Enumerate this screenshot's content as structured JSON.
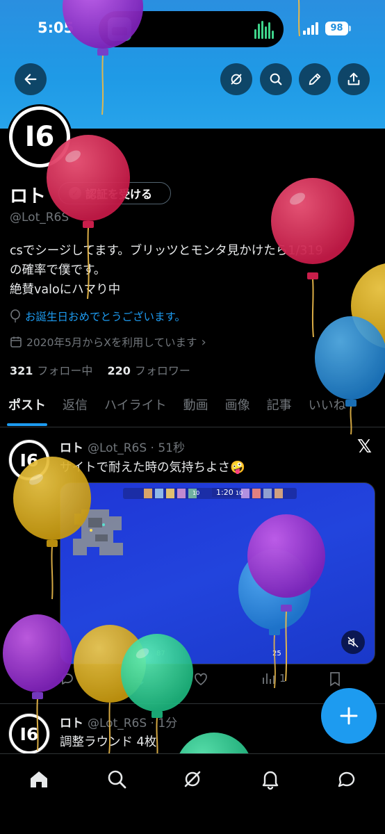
{
  "status_bar": {
    "time": "5:05",
    "battery": "98"
  },
  "header": {
    "back": "back-arrow",
    "grok": "grok-icon",
    "search": "search-icon",
    "edit": "pencil-icon",
    "share": "share-icon"
  },
  "profile": {
    "name": "ロト",
    "verify_label": "認証を受ける",
    "handle": "@Lot_R6S",
    "bio": "csでシージしてます。ブリッツとモンタ見かけたら1/319\nの確率で僕です。\n絶賛valoにハマり中",
    "birthday": "お誕生日おめでとうございます。",
    "joined": "2020年5月からXを利用しています",
    "following_count": "321",
    "following_label": "フォロー中",
    "followers_count": "220",
    "followers_label": "フォロワー",
    "logo_text": "I6"
  },
  "tabs": [
    "ポスト",
    "返信",
    "ハイライト",
    "動画",
    "画像",
    "記事",
    "いいね"
  ],
  "posts": [
    {
      "name": "ロト",
      "meta": "@Lot_R6S · 51秒",
      "text": "サイトで耐えた時の気持ちよさ🤪",
      "views": "1",
      "media": {
        "timer": "1:20",
        "score_left": "10",
        "score_right": "10",
        "hp": "87",
        "ammo": "25"
      }
    },
    {
      "name": "ロト",
      "meta": "@Lot_R6S · 1分",
      "text": "調整ラウンド 4枚"
    }
  ],
  "nav": [
    "home-icon",
    "search-icon",
    "grok-icon",
    "notifications-icon",
    "messages-icon"
  ],
  "colors": {
    "accent": "#1d9bf0",
    "banner": "#1f9ae6",
    "background": "#000000"
  }
}
